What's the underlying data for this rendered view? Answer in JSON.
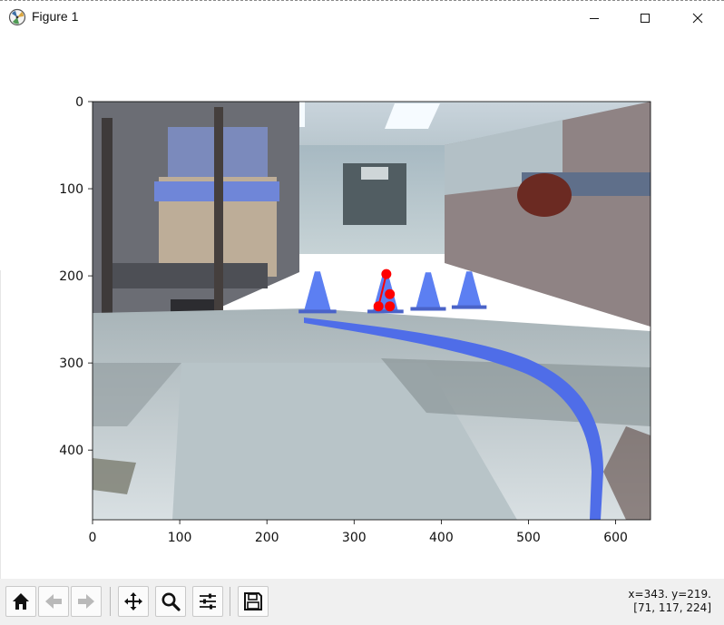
{
  "window": {
    "title": "Figure 1",
    "controls": [
      "minimize",
      "maximize",
      "close"
    ]
  },
  "axes": {
    "xlim": [
      0,
      640
    ],
    "ylim": [
      480,
      0
    ],
    "y_inverted": true,
    "xticks": [
      0,
      100,
      200,
      300,
      400,
      500,
      600
    ],
    "yticks": [
      0,
      100,
      200,
      300,
      400
    ],
    "xtick_labels": [
      "0",
      "100",
      "200",
      "300",
      "400",
      "500",
      "600"
    ],
    "ytick_labels": [
      "0",
      "100",
      "200",
      "300",
      "400"
    ],
    "image": "camera photo of lab floor with blue traffic cones and a curved blue tape line"
  },
  "chart_data": {
    "type": "scatter",
    "title": "",
    "xlabel": "",
    "ylabel": "",
    "xlim": [
      0,
      640
    ],
    "ylim": [
      480,
      0
    ],
    "series": [
      {
        "color": "#ff0000",
        "marker": "circle",
        "points": [
          {
            "x": 337,
            "y": 198
          },
          {
            "x": 341,
            "y": 221
          },
          {
            "x": 328,
            "y": 235
          },
          {
            "x": 341,
            "y": 235
          }
        ]
      }
    ],
    "overlay_line": {
      "color": "#ff0000",
      "points": [
        {
          "x": 337,
          "y": 198
        },
        {
          "x": 328,
          "y": 235
        }
      ]
    },
    "background_image_scene": {
      "cones": [
        {
          "x": 258,
          "y_top": 195,
          "y_base": 243
        },
        {
          "x": 336,
          "y_top": 198,
          "y_base": 243
        },
        {
          "x": 385,
          "y_top": 196,
          "y_base": 240
        },
        {
          "x": 432,
          "y_top": 195,
          "y_base": 238
        }
      ],
      "cone_color": "#5c7ff2",
      "tape_color": "#4f6de8",
      "floor_colors": [
        "#d6dde0",
        "#a9b6ba",
        "#c5d0d3",
        "#8a9698"
      ]
    }
  },
  "toolbar": {
    "buttons": [
      {
        "name": "home",
        "icon": "home-icon"
      },
      {
        "name": "back",
        "icon": "arrow-left-icon"
      },
      {
        "name": "forward",
        "icon": "arrow-right-icon"
      },
      {
        "name": "pan",
        "icon": "move-icon"
      },
      {
        "name": "zoom",
        "icon": "magnifier-icon"
      },
      {
        "name": "configure",
        "icon": "sliders-icon"
      },
      {
        "name": "save",
        "icon": "floppy-icon"
      }
    ],
    "coord_line1": "x=343. y=219.",
    "coord_line2": "[71, 117, 224]"
  }
}
